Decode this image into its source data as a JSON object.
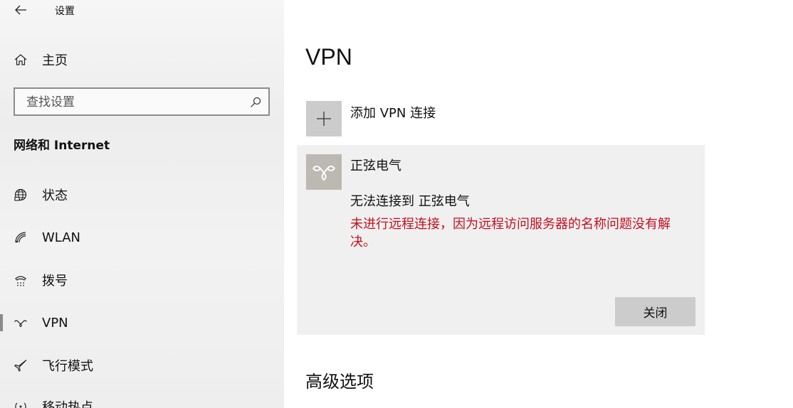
{
  "window": {
    "title": "设置"
  },
  "sidebar": {
    "home_label": "主页",
    "search": {
      "placeholder": "查找设置",
      "value": ""
    },
    "section_title": "网络和 Internet",
    "items": [
      {
        "label": "状态",
        "icon": "globe-icon"
      },
      {
        "label": "WLAN",
        "icon": "wifi-icon"
      },
      {
        "label": "拨号",
        "icon": "dialup-icon"
      },
      {
        "label": "VPN",
        "icon": "vpn-icon",
        "selected": true
      },
      {
        "label": "飞行模式",
        "icon": "airplane-icon"
      },
      {
        "label": "移动热点",
        "icon": "hotspot-icon"
      }
    ]
  },
  "main": {
    "title": "VPN",
    "add_vpn_label": "添加 VPN 连接",
    "connection": {
      "name": "正弦电气",
      "status": "无法连接到 正弦电气",
      "error": "未进行远程连接，因为远程访问服务器的名称问题没有解决。",
      "close_label": "关闭"
    },
    "advanced_title": "高级选项"
  },
  "colors": {
    "error_text": "#c50f1f",
    "tile_gray": "#cccccc",
    "vpn_tile": "#bcb8b2",
    "card_bg": "#f0f0f0"
  }
}
